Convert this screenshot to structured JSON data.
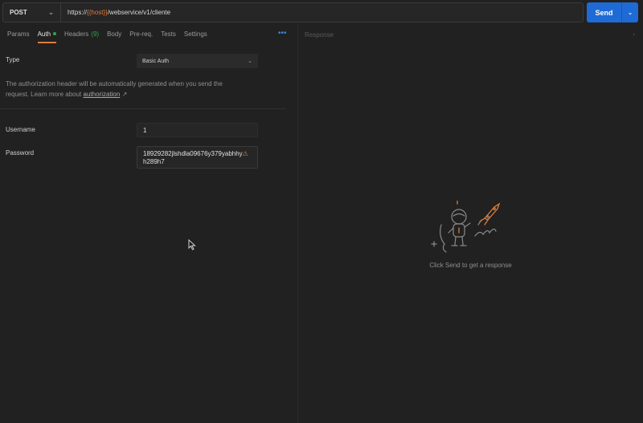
{
  "request": {
    "method": "POST",
    "url_prefix": "https://",
    "url_variable": "{{host}}",
    "url_suffix": "/webservice/v1/cliente",
    "send_label": "Send"
  },
  "tabs": [
    {
      "label": "Params"
    },
    {
      "label": "Auth"
    },
    {
      "label": "Headers",
      "count": "(9)"
    },
    {
      "label": "Body"
    },
    {
      "label": "Pre-req."
    },
    {
      "label": "Tests"
    },
    {
      "label": "Settings"
    }
  ],
  "more_label": "•••",
  "auth": {
    "type_label": "Type",
    "type_value": "Basic Auth",
    "help_text": "The authorization header will be automatically generated when you send the request. Learn more about",
    "help_link": "authorization",
    "help_link_arrow": "↗",
    "username_label": "Username",
    "username_value": "1",
    "password_label": "Password",
    "password_value": "18929282jlshdla09676y379yabhhy",
    "password_warn": "⚠",
    "password_value_2": "h289h7"
  },
  "response": {
    "title": "Response",
    "empty_text": "Click Send to get a response"
  },
  "icons": {
    "method_dropdown": "chevron-down-icon",
    "send_dropdown": "chevron-down-icon",
    "type_dropdown": "chevron-down-icon",
    "response_collapse": "chevron-right-icon",
    "illustration": "astronaut-rocket-illustration"
  },
  "colors": {
    "accent": "#e07b39",
    "send_button": "#1f6bd6",
    "success": "#2fa84f",
    "background": "#212121"
  }
}
